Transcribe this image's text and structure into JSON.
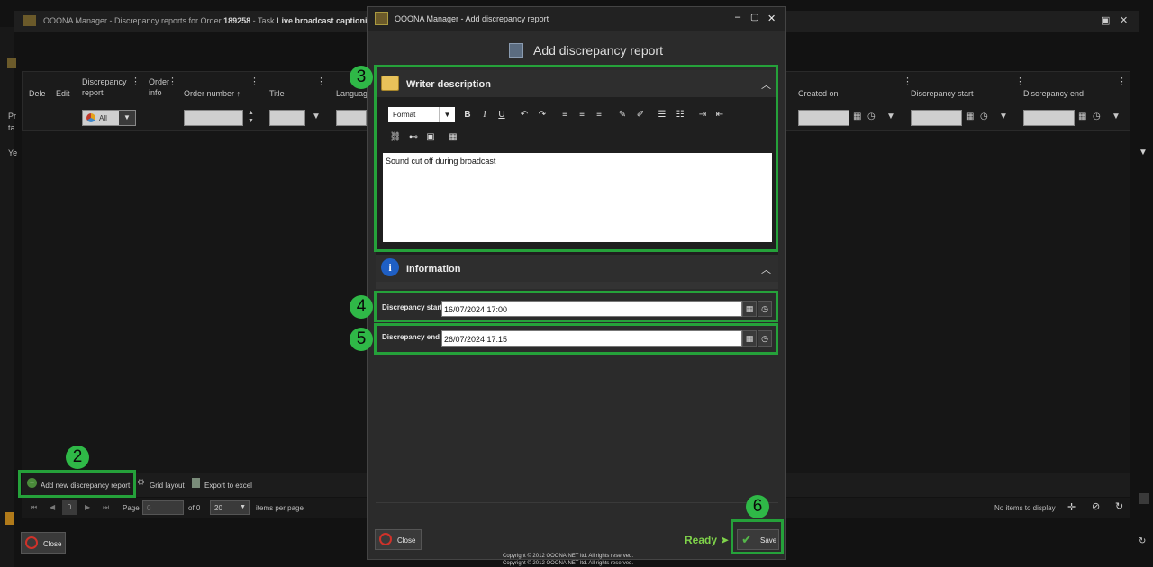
{
  "background": {
    "title_prefix": "OOONA Manager - Discrepancy reports for Order ",
    "order_number": "189258",
    "title_mid": " - Task ",
    "task_name": "Live broadcast captioning",
    "columns": [
      {
        "label": "Dele"
      },
      {
        "label": "Edit"
      },
      {
        "label": "Discrepancy report"
      },
      {
        "label": "Order info"
      },
      {
        "label": "Order number ↑"
      },
      {
        "label": "Title"
      },
      {
        "label": "Languag"
      },
      {
        "label": "Created on"
      },
      {
        "label": "Discrepancy start"
      },
      {
        "label": "Discrepancy end"
      }
    ],
    "filter_all": "All",
    "left_labels": [
      "Pr",
      "ta",
      "Ye"
    ],
    "footer": {
      "add_label": "Add new discrepancy report",
      "grid_label": "Grid layout",
      "export_label": "Export to excel"
    },
    "pager": {
      "page_label": "Page",
      "current_page": "0",
      "page_input": "0",
      "of_label": "of 0",
      "per_page": "20",
      "per_page_label": "items per page",
      "no_items": "No items to display"
    },
    "close_label": "Close"
  },
  "modal": {
    "window_title": "OOONA Manager - Add discrepancy report",
    "header": "Add discrepancy report",
    "writer_section": {
      "title": "Writer description",
      "format_label": "Format",
      "content": "Sound cut off during broadcast"
    },
    "info_section": {
      "title": "Information",
      "start_label": "Discrepancy start",
      "start_value": "16/07/2024 17:00",
      "end_label": "Discrepancy end",
      "end_value": "26/07/2024 17:15"
    },
    "close_label": "Close",
    "ready_label": "Ready ➤",
    "save_label": "Save",
    "copyright_line1": "Copyright © 2012 OOONA.NET ltd. All rights reserved.",
    "copyright_line2": "Copyright © 2012 OOONA.NET ltd. All rights reserved."
  },
  "steps": [
    "2",
    "3",
    "4",
    "5",
    "6"
  ],
  "colors": {
    "highlight": "#25a13a",
    "step_badge": "#2fb847",
    "ready_text": "#7fd34a"
  }
}
